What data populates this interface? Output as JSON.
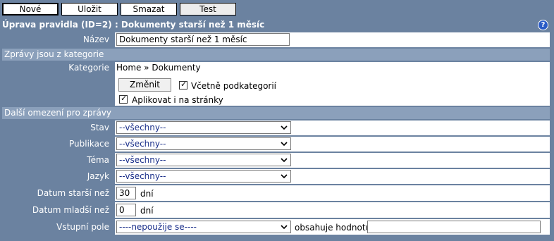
{
  "toolbar": {
    "new_label": "Nové",
    "save_label": "Uložit",
    "delete_label": "Smazat",
    "test_label": "Test"
  },
  "title": "Úprava pravidla (ID=2) : Dokumenty starší než 1 měsíc",
  "help_icon": "help-icon",
  "form": {
    "name_label": "Název",
    "name_value": "Dokumenty starší než 1 měsíc",
    "section_categories": "Zprávy jsou z kategorie",
    "category_label": "Kategorie",
    "category_path": "Home » Dokumenty",
    "change_button": "Změnit",
    "include_subcategories_label": "Včetně podkategorií",
    "include_subcategories_checked": true,
    "apply_to_pages_label": "Aplikovat i na stránky",
    "apply_to_pages_checked": true,
    "section_other": "Další omezení pro zprávy",
    "status_label": "Stav",
    "status_value": "--všechny--",
    "publication_label": "Publikace",
    "publication_value": "--všechny--",
    "topic_label": "Téma",
    "topic_value": "--všechny--",
    "language_label": "Jazyk",
    "language_value": "--všechny--",
    "older_label": "Datum starší než",
    "older_value": "30",
    "older_unit": "dní",
    "younger_label": "Datum mladší než",
    "younger_value": "0",
    "younger_unit": "dní",
    "input_field_label": "Vstupní pole",
    "input_field_value": "----nepoužije se----",
    "contains_label": "obsahuje hodnotu",
    "contains_value": ""
  },
  "colors": {
    "background": "#6b82a0",
    "section": "#8ba0bb",
    "select_text": "#1a2f8a"
  }
}
